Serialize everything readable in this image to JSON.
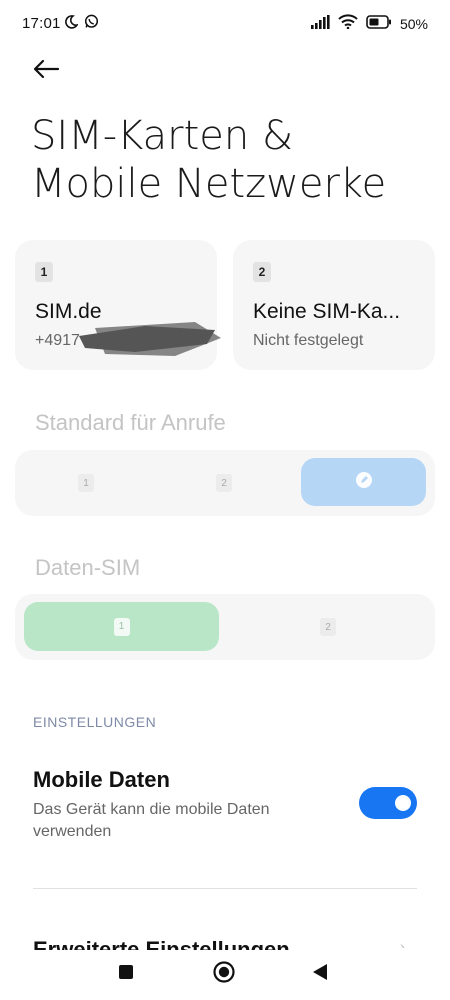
{
  "status_bar": {
    "time": "17:01",
    "battery_percent": "50%"
  },
  "page": {
    "title": "SIM-Karten & Mobile Netzwerke"
  },
  "sim_cards": [
    {
      "slot": "1",
      "name": "SIM.de",
      "number": "+4917"
    },
    {
      "slot": "2",
      "name": "Keine SIM-Ka...",
      "status": "Nicht festgelegt"
    }
  ],
  "calls": {
    "label": "Standard für Anrufe",
    "options": [
      "1",
      "2"
    ],
    "selected_option": "edit-icon"
  },
  "data_sim": {
    "label": "Daten-SIM",
    "options": [
      "1",
      "2"
    ],
    "selected": "1"
  },
  "settings": {
    "header": "EINSTELLUNGEN",
    "mobile_data_title": "Mobile Daten",
    "mobile_data_desc": "Das Gerät kann die mobile Daten verwenden",
    "mobile_data_on": true,
    "next_item": "Erweiterte Einstellungen"
  },
  "colors": {
    "accent": "#1976f3",
    "calls_selected": "#b6d6f6",
    "data_selected": "#b9e6c7"
  },
  "nav": {
    "icons": [
      "recents-square-icon",
      "home-circle-icon",
      "back-triangle-icon"
    ]
  }
}
